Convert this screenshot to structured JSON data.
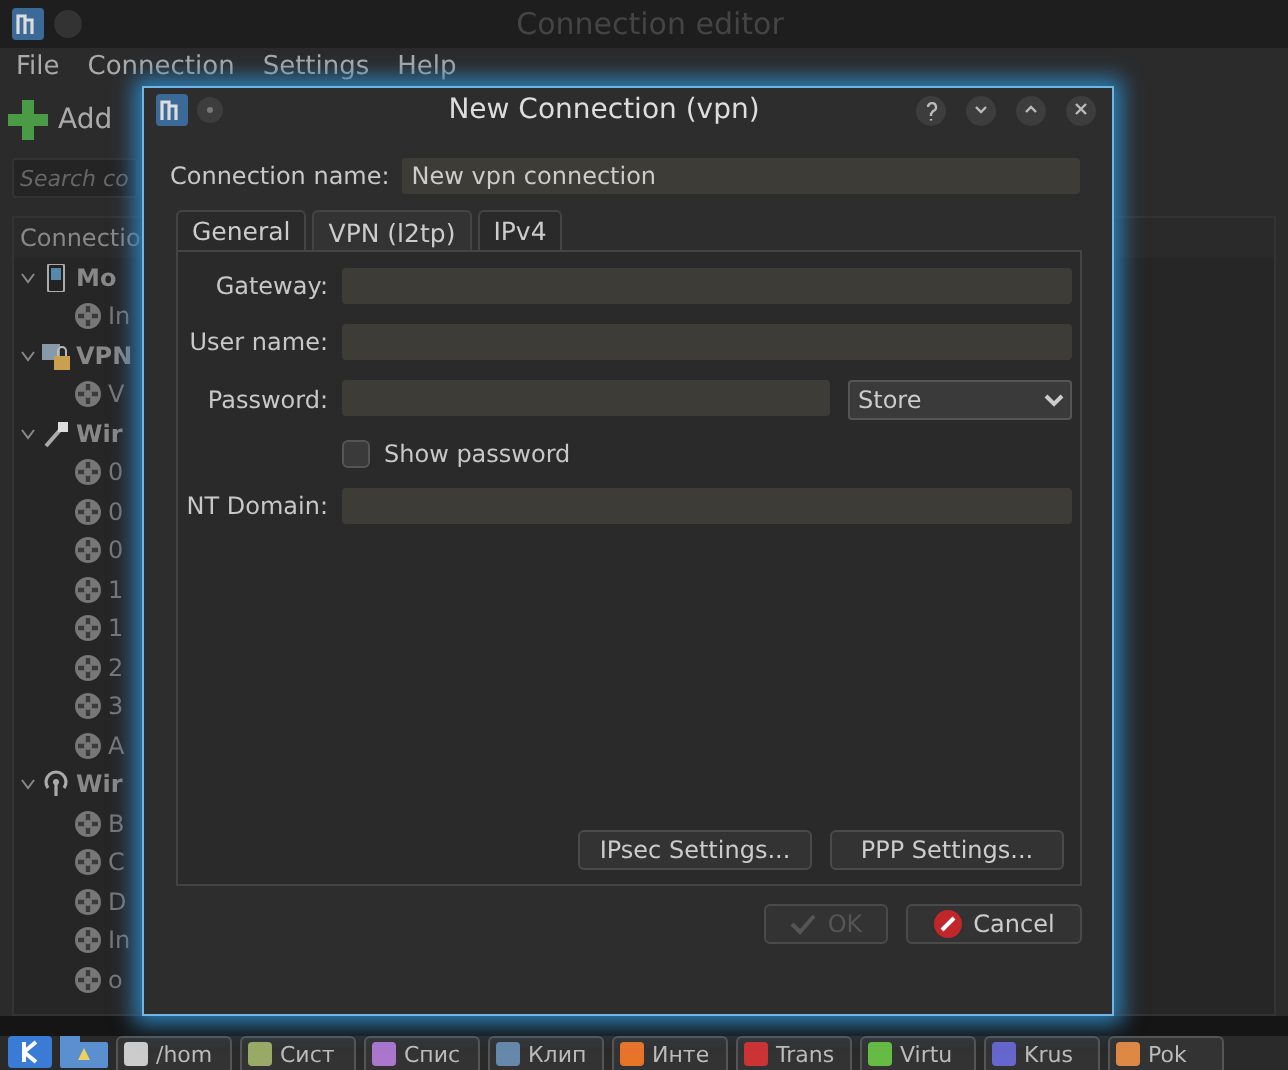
{
  "background_window": {
    "title": "Connection editor",
    "menu": [
      "File",
      "Connection",
      "Settings",
      "Help"
    ],
    "add_button": "Add",
    "search": {
      "placeholder": "Search co"
    },
    "tree": {
      "header": "Connectio",
      "groups": [
        {
          "label": "Mo",
          "kind": "mobile",
          "expanded": true,
          "children": [
            {
              "label": "In"
            }
          ]
        },
        {
          "label": "VPN",
          "kind": "vpn",
          "expanded": true,
          "children": [
            {
              "label": "V"
            }
          ]
        },
        {
          "label": "Wir",
          "kind": "wired",
          "expanded": true,
          "children": [
            {
              "label": "0"
            },
            {
              "label": "0"
            },
            {
              "label": "0"
            },
            {
              "label": "1"
            },
            {
              "label": "1"
            },
            {
              "label": "2"
            },
            {
              "label": "3"
            },
            {
              "label": "A"
            }
          ]
        },
        {
          "label": "Wir",
          "kind": "wireless",
          "expanded": true,
          "children": [
            {
              "label": "B"
            },
            {
              "label": "C"
            },
            {
              "label": "D"
            },
            {
              "label": "In"
            },
            {
              "label": "o"
            }
          ]
        }
      ]
    }
  },
  "dialog": {
    "title": "New Connection (vpn)",
    "connection_name": {
      "label": "Connection name:",
      "value": "New vpn connection"
    },
    "tabs": [
      {
        "label": "General",
        "selected": false
      },
      {
        "label": "VPN (l2tp)",
        "selected": true
      },
      {
        "label": "IPv4",
        "selected": false
      }
    ],
    "fields": [
      {
        "kind": "text",
        "label": "Gateway:"
      },
      {
        "kind": "text",
        "label": "User name:"
      },
      {
        "kind": "password",
        "label": "Password:",
        "store": "Store"
      },
      {
        "kind": "checkbox",
        "label": "Show password",
        "checked": false
      },
      {
        "kind": "text",
        "label": "NT Domain:"
      }
    ],
    "panel_buttons": [
      "IPsec Settings...",
      "PPP Settings..."
    ],
    "ok": {
      "label": "OK",
      "disabled": true
    },
    "cancel": {
      "label": "Cancel"
    }
  },
  "taskbar": {
    "items": [
      {
        "label": "/hom",
        "kind": "terminal"
      },
      {
        "label": "Сист",
        "kind": "monitor"
      },
      {
        "label": "Спис",
        "kind": "list"
      },
      {
        "label": "Клип",
        "kind": "clipboard"
      },
      {
        "label": "Инте",
        "kind": "browser"
      },
      {
        "label": "Trans",
        "kind": "torrent"
      },
      {
        "label": "Virtu",
        "kind": "vm"
      },
      {
        "label": "Krus",
        "kind": "files"
      },
      {
        "label": "Pok",
        "kind": "game"
      }
    ]
  }
}
